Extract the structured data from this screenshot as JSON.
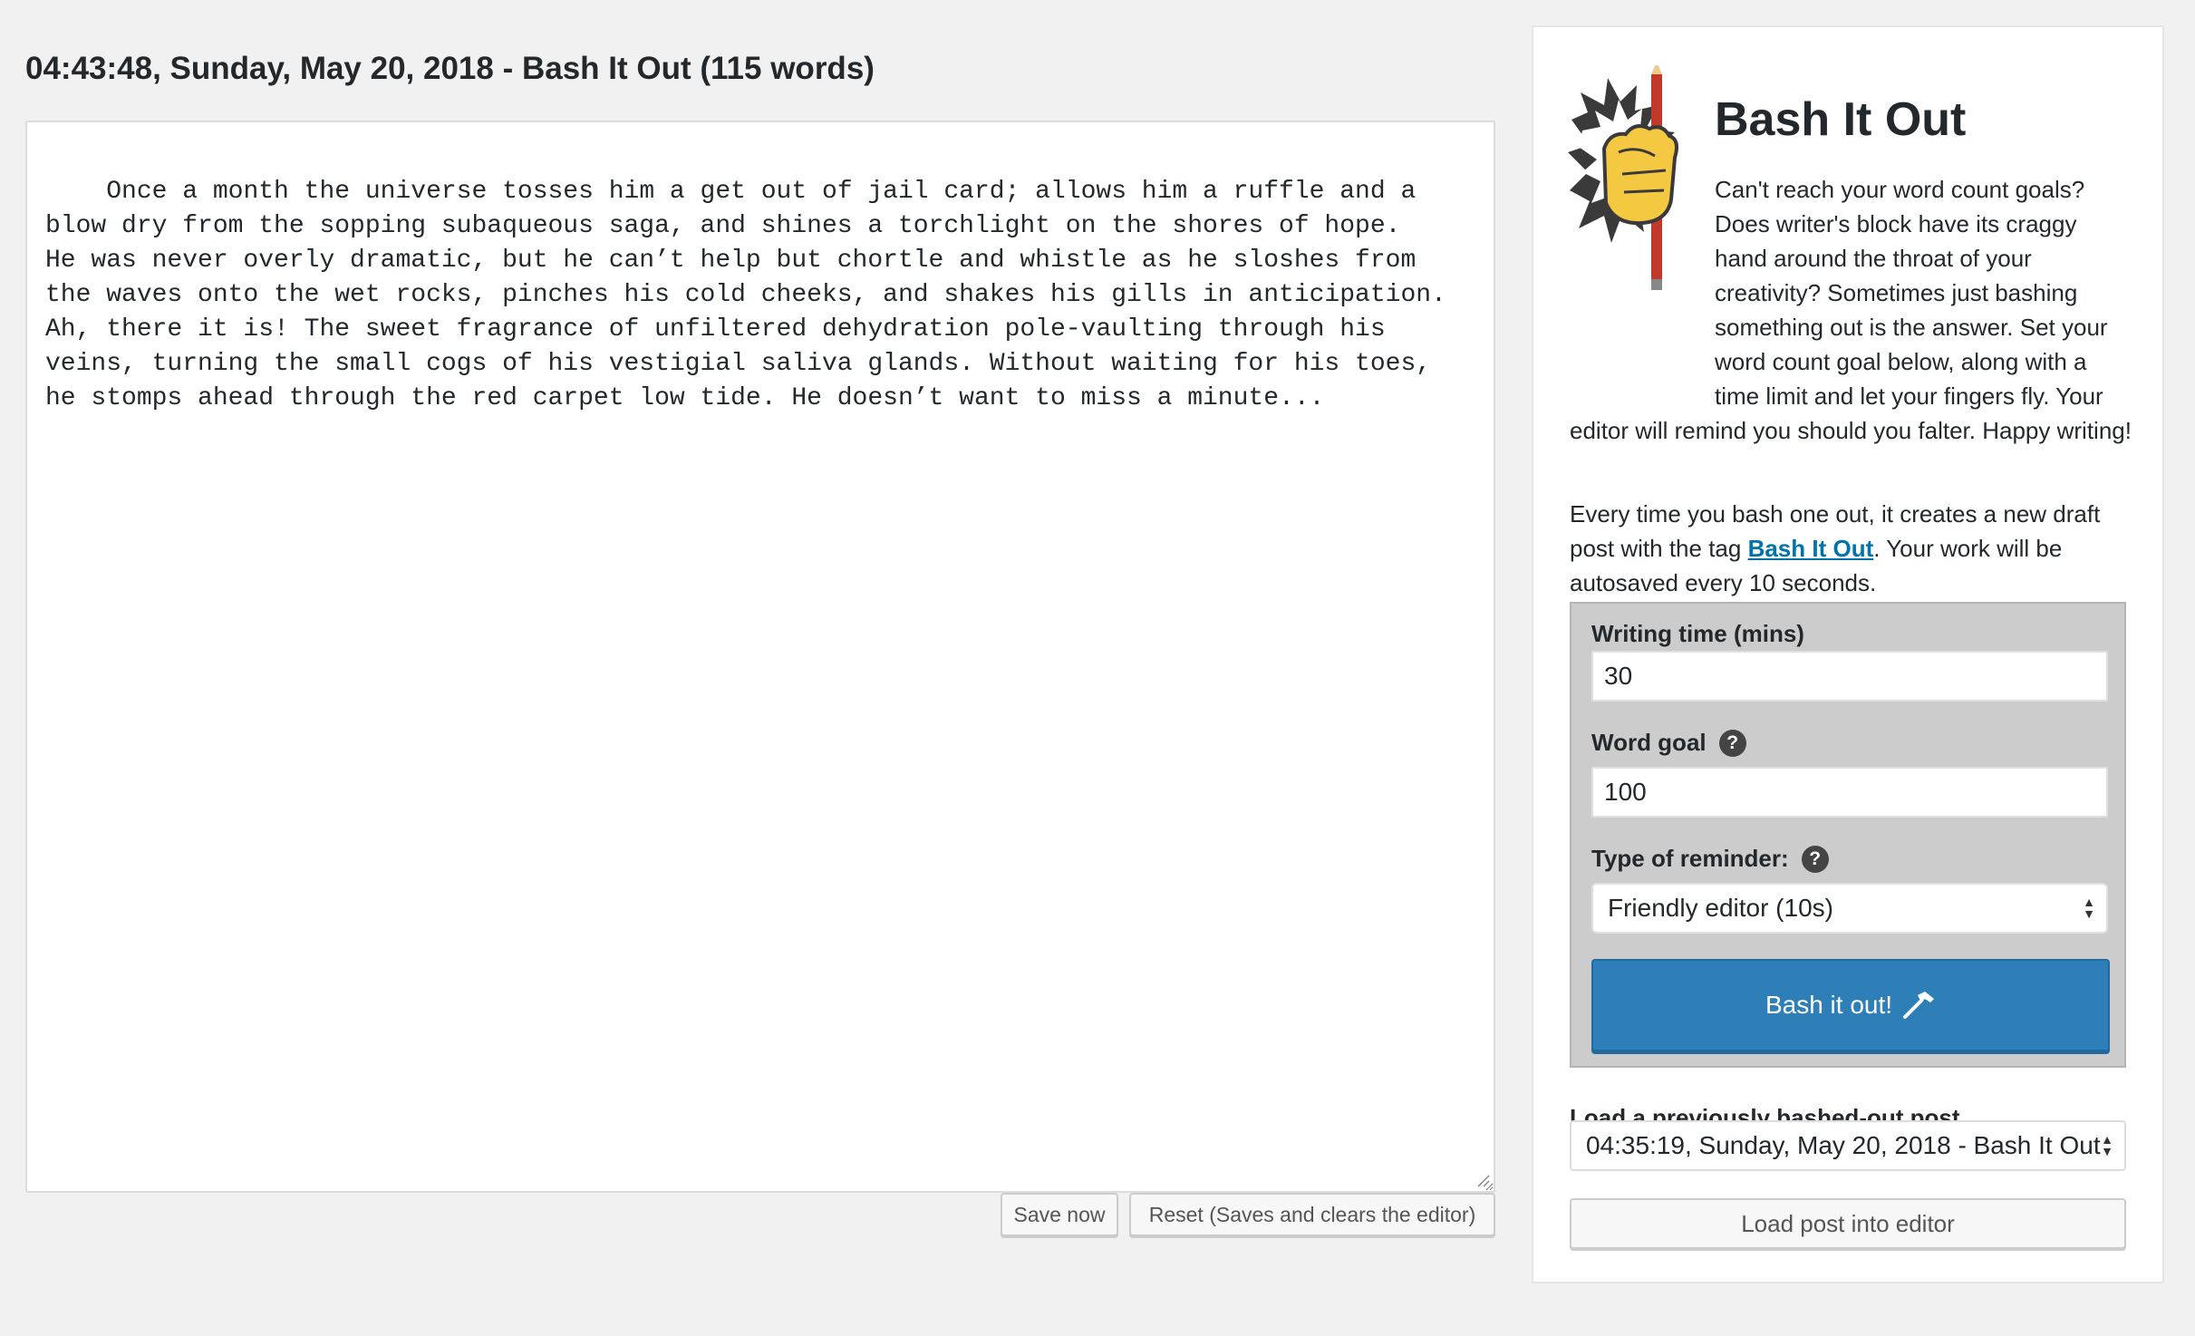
{
  "editor": {
    "title": "04:43:48, Sunday, May 20, 2018 - Bash It Out (115 words)",
    "content": "Once a month the universe tosses him a get out of jail card; allows him a ruffle and a blow dry from the sopping subaqueous saga, and shines a torchlight on the shores of hope.\nHe was never overly dramatic, but he can’t help but chortle and whistle as he sloshes from the waves onto the wet rocks, pinches his cold cheeks, and shakes his gills in anticipation. Ah, there it is! The sweet fragrance of unfiltered dehydration pole-vaulting through his veins, turning the small cogs of his vestigial saliva glands. Without waiting for his toes, he stomps ahead through the red carpet low tide. He doesn’t want to miss a minute...",
    "save_label": "Save now",
    "reset_label": "Reset (Saves and clears the editor)"
  },
  "panel": {
    "title": "Bash It Out",
    "intro": "Can't reach your word count goals? Does writer's block have its craggy hand around the throat of your creativity? Sometimes just bashing something out is the answer. Set your word count goal below, along with a time limit and let your fingers fly. Your editor will remind you should you falter. Happy writing!",
    "para2_before": "Every time you bash one out, it creates a new draft post with the tag ",
    "para2_link": "Bash It Out",
    "para2_after": ". Your work will be autosaved every 10 seconds.",
    "settings": {
      "time_label": "Writing time (mins)",
      "time_value": "30",
      "goal_label": "Word goal",
      "goal_value": "100",
      "reminder_label": "Type of reminder:",
      "reminder_value": "Friendly editor (10s)",
      "submit_label": "Bash it out!"
    },
    "load_label": "Load a previously bashed-out post",
    "load_value": "04:35:19, Sunday, May 20, 2018 - Bash It Out",
    "load_button": "Load post into editor"
  },
  "colors": {
    "primary": "#2e7fb8",
    "link": "#0073aa",
    "background": "#f1f1f1"
  },
  "icons": [
    "fist-pencil-logo-icon",
    "help-icon",
    "hammer-icon",
    "select-arrows-icon",
    "resize-grip-icon"
  ]
}
